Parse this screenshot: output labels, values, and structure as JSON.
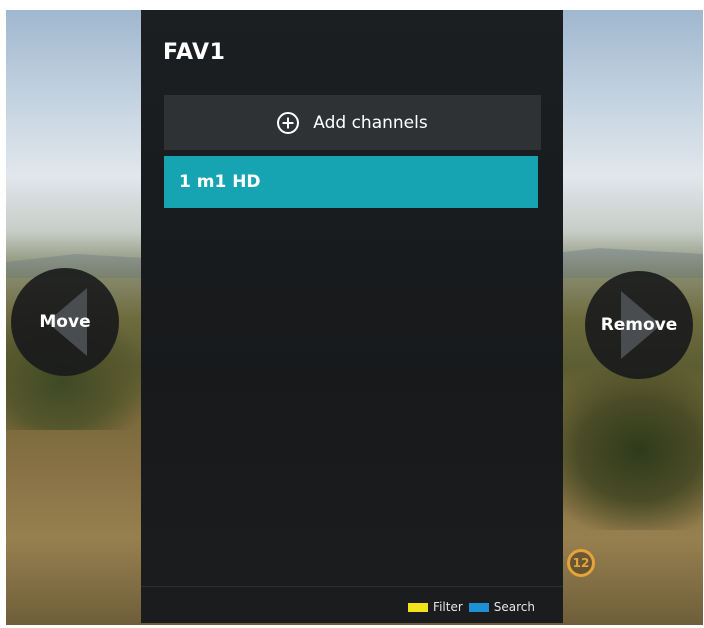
{
  "panel": {
    "title": "FAV1",
    "add_channels_label": "Add channels",
    "channels": [
      {
        "label": "1 m1 HD",
        "selected": true
      }
    ]
  },
  "nav": {
    "move_label": "Move",
    "remove_label": "Remove"
  },
  "footer": {
    "filter_label": "Filter",
    "search_label": "Search"
  },
  "age_rating": "12",
  "colors": {
    "highlight": "#16a4b2",
    "filter_key": "#f2e21c",
    "search_key": "#1f8fd6",
    "rating": "#e5a33a"
  },
  "icons": {
    "add": "plus-circle-icon",
    "move": "chevron-left-icon",
    "remove": "chevron-right-icon"
  }
}
